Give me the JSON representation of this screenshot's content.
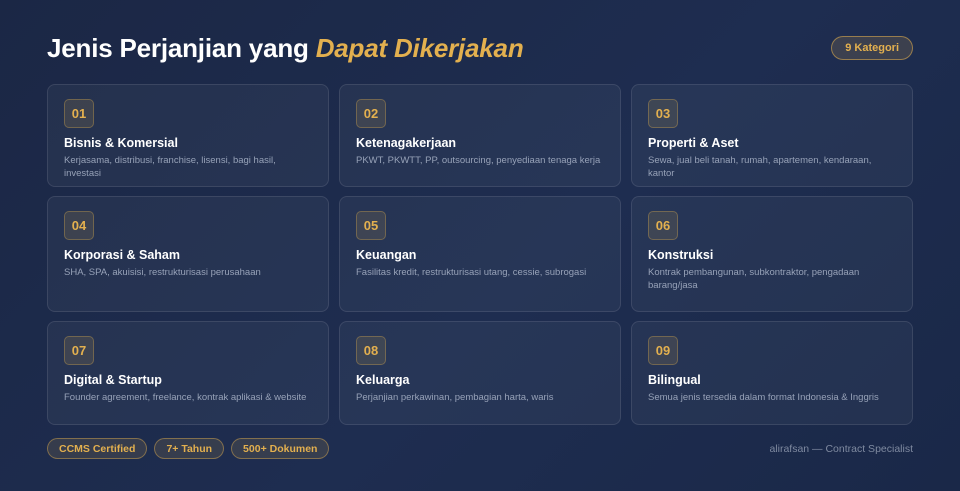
{
  "header": {
    "title_main": "Jenis Perjanjian yang ",
    "title_accent": "Dapat Dikerjakan",
    "category_count": "9 Kategori"
  },
  "colors": {
    "accent": "#e3b04f",
    "background": "#1e2d50",
    "muted_text": "#97a2b8"
  },
  "categories": [
    {
      "number": "01",
      "title": "Bisnis & Komersial",
      "desc": "Kerjasama, distribusi, franchise, lisensi, bagi hasil, investasi"
    },
    {
      "number": "02",
      "title": "Ketenagakerjaan",
      "desc": "PKWT, PKWTT, PP, outsourcing, penyediaan tenaga kerja"
    },
    {
      "number": "03",
      "title": "Properti & Aset",
      "desc": "Sewa, jual beli tanah, rumah, apartemen, kendaraan, kantor"
    },
    {
      "number": "04",
      "title": "Korporasi & Saham",
      "desc": "SHA, SPA, akuisisi, restrukturisasi perusahaan"
    },
    {
      "number": "05",
      "title": "Keuangan",
      "desc": "Fasilitas kredit, restrukturisasi utang, cessie, subrogasi"
    },
    {
      "number": "06",
      "title": "Konstruksi",
      "desc": "Kontrak pembangunan, subkontraktor, pengadaan barang/jasa"
    },
    {
      "number": "07",
      "title": "Digital & Startup",
      "desc": "Founder agreement, freelance, kontrak aplikasi & website"
    },
    {
      "number": "08",
      "title": "Keluarga",
      "desc": "Perjanjian perkawinan, pembagian harta, waris"
    },
    {
      "number": "09",
      "title": "Bilingual",
      "desc": "Semua jenis tersedia dalam format Indonesia & Inggris"
    }
  ],
  "footer": {
    "badges": [
      "CCMS Certified",
      "7+ Tahun",
      "500+ Dokumen"
    ],
    "credit": "alirafsan — Contract Specialist"
  }
}
